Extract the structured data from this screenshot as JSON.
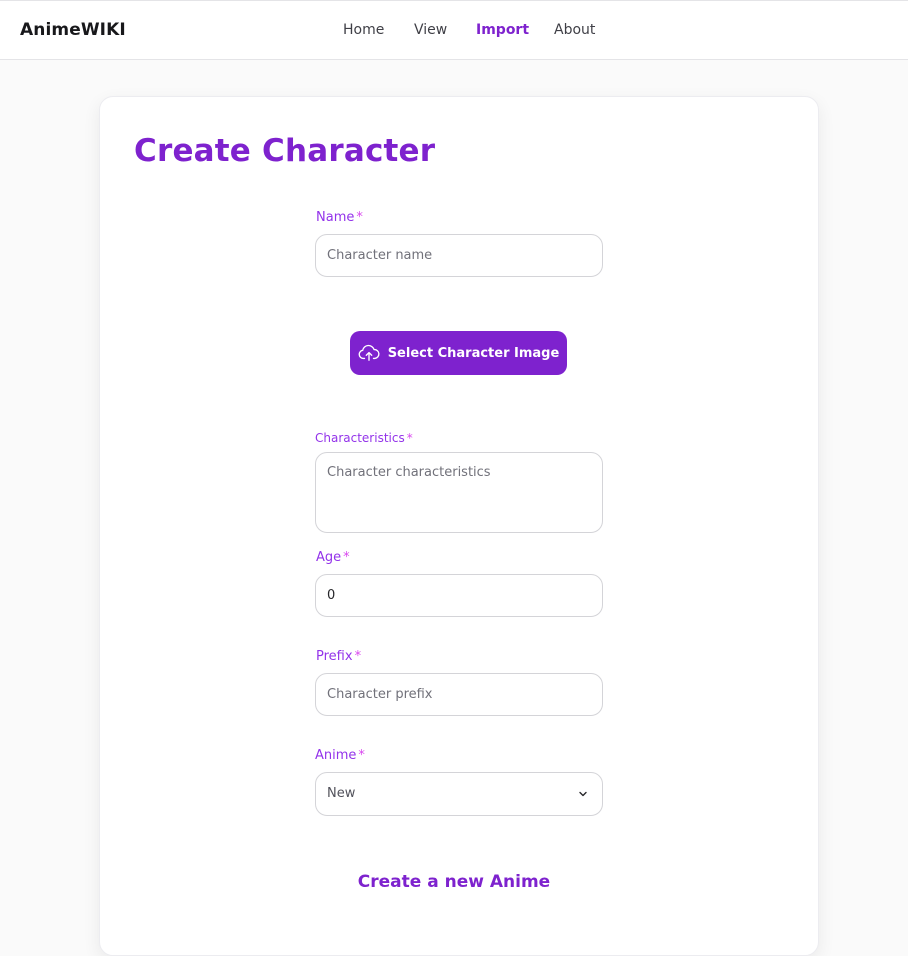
{
  "navbar": {
    "brand": "AnimeWIKI",
    "links": [
      {
        "label": "Home"
      },
      {
        "label": "View"
      },
      {
        "label": "Import",
        "active": true
      },
      {
        "label": "About"
      }
    ]
  },
  "page": {
    "title": "Create Character"
  },
  "form": {
    "required_mark": "*",
    "name": {
      "label": "Name",
      "placeholder": "Character name",
      "value": ""
    },
    "image_button": {
      "label": "Select Character Image",
      "icon": "cloud-upload-icon"
    },
    "characteristics": {
      "label": "Characteristics",
      "placeholder": "Character characteristics",
      "value": ""
    },
    "age": {
      "label": "Age",
      "value": "0"
    },
    "prefix": {
      "label": "Prefix",
      "placeholder": "Character prefix",
      "value": ""
    },
    "anime": {
      "label": "Anime",
      "selected": "New",
      "icon": "chevron-down-icon"
    },
    "create_anime_link": "Create a new Anime"
  },
  "colors": {
    "accent": "#7e22ce",
    "label": "#9333ea",
    "required": "#d946ef"
  }
}
